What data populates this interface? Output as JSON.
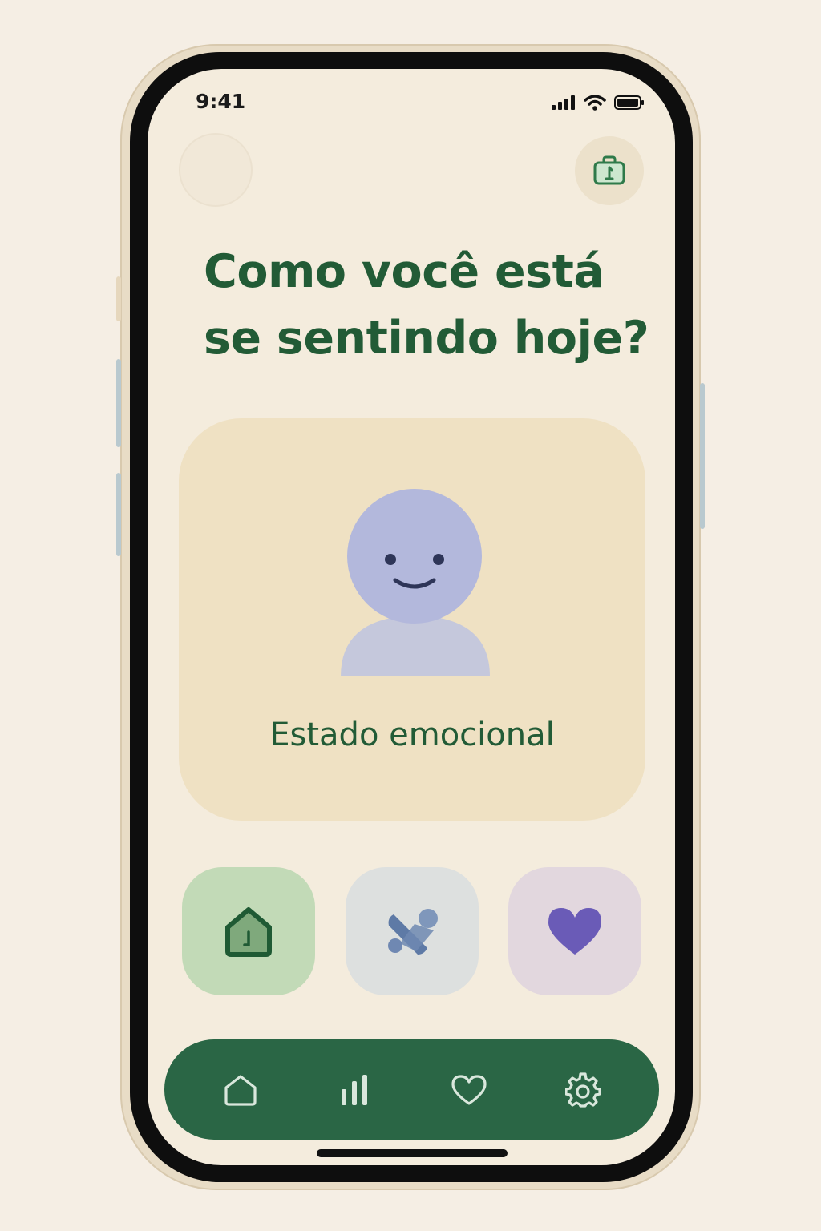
{
  "status_bar": {
    "time": "9:41",
    "icons": [
      "cellular-signal-icon",
      "wifi-icon",
      "battery-icon"
    ]
  },
  "header": {
    "profile": "avatar",
    "action_icon": "briefcase-icon"
  },
  "headline": {
    "line1": "Como você está",
    "line2": "se sentindo hoje?"
  },
  "mood_card": {
    "label": "Estado emocional",
    "illustration_icon": "smiling-person-icon"
  },
  "quick_tiles": [
    {
      "icon": "house-icon",
      "color": "#c2dab7"
    },
    {
      "icon": "bandage-icon",
      "color": "#dde0df"
    },
    {
      "icon": "heart-icon",
      "color": "#e2d7de"
    }
  ],
  "bottom_nav": {
    "items": [
      "home-icon",
      "bar-chart-icon",
      "heart-outline-icon",
      "gear-icon"
    ]
  },
  "colors": {
    "primary_green": "#225b36",
    "nav_green": "#2a6645",
    "background": "#f4ecdd",
    "card": "#efe1c3",
    "lavender": "#b3b8dc",
    "purple": "#6a5bb7"
  }
}
